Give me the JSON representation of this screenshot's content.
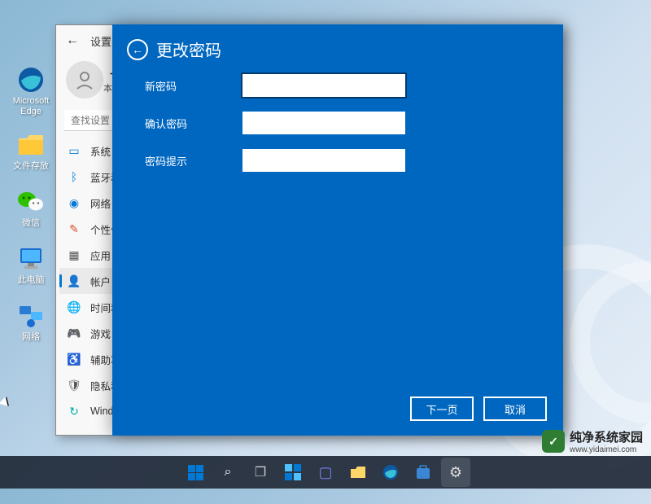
{
  "desktop_icons": [
    {
      "label": "Microsoft Edge"
    },
    {
      "label": "文件存放"
    },
    {
      "label": "微信"
    },
    {
      "label": "此电脑"
    },
    {
      "label": "网络"
    }
  ],
  "settings": {
    "title": "设置",
    "account_name": "十",
    "account_sub": "本",
    "search_placeholder": "查找设置",
    "nav": [
      {
        "label": "系统",
        "icon": "system"
      },
      {
        "label": "蓝牙和",
        "icon": "bluetooth"
      },
      {
        "label": "网络 &",
        "icon": "wifi"
      },
      {
        "label": "个性化",
        "icon": "personalize"
      },
      {
        "label": "应用",
        "icon": "apps"
      },
      {
        "label": "帐户",
        "icon": "account",
        "active": true
      },
      {
        "label": "时间和",
        "icon": "time"
      },
      {
        "label": "游戏",
        "icon": "gaming"
      },
      {
        "label": "辅助功",
        "icon": "accessibility"
      },
      {
        "label": "隐私和",
        "icon": "privacy"
      },
      {
        "label": "Windo",
        "icon": "update"
      }
    ]
  },
  "modal": {
    "title": "更改密码",
    "fields": [
      {
        "label": "新密码"
      },
      {
        "label": "确认密码"
      },
      {
        "label": "密码提示"
      }
    ],
    "next_btn": "下一页",
    "cancel_btn": "取消"
  },
  "watermark": {
    "text": "纯净系统家园",
    "url": "www.yidaimei.com"
  }
}
